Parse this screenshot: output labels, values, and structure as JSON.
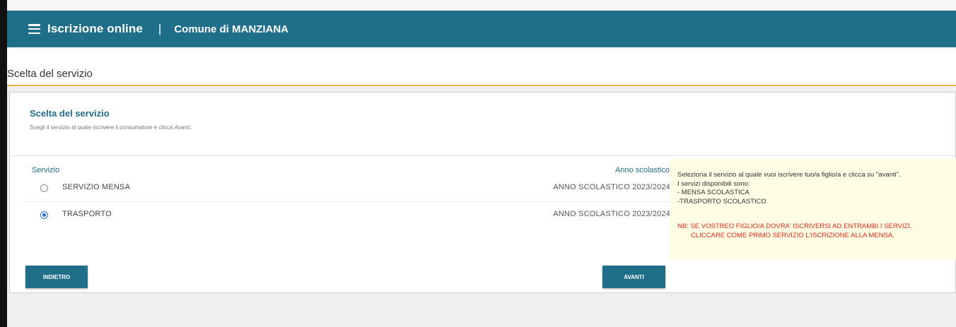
{
  "navbar": {
    "menu_icon": "hamburger-menu-icon",
    "title": "Iscrizione online",
    "separator": "|",
    "comune": "Comune di MANZIANA"
  },
  "page": {
    "title": "Scelta del servizio"
  },
  "card": {
    "title": "Scelta del servizio",
    "subtitle_prefix": "Scegli il servizio al quale iscrivere il consumatore e clicca ",
    "subtitle_italic": "Avanti",
    "subtitle_suffix": ".",
    "columns": {
      "service": "Servizio",
      "year": "Anno scolastico"
    },
    "services": [
      {
        "name": "SERVIZIO MENSA",
        "year": "ANNO SCOLASTICO 2023/2024",
        "selected": false
      },
      {
        "name": "TRASPORTO",
        "year": "ANNO SCOLASTICO 2023/2024",
        "selected": true
      }
    ]
  },
  "info": {
    "line1": "Seleziona il servizio al quale vuoi iscrivere tuo/a figlio/a e clicca su \"avanti\".",
    "line2": "I servizi disponibili sono:",
    "line3": "- MENSA SCOLASTICA",
    "line4": "-TRASPORTO SCOLASTICO",
    "nb1": "NB: SE VOSTREO FIGLIO/A DOVRA' ISCRIVERSI AD ENTRAMBI I SERVIZI.",
    "nb2": "CLICCARE COME PRIMO SERVIZIO L'ISCRIZIONE ALLA MENSA."
  },
  "buttons": {
    "back": "INDIETRO",
    "next": "AVANTI"
  },
  "colors": {
    "primary": "#1f6f8b",
    "accent_line": "#e8b24a",
    "info_bg": "#fffde3",
    "warning_text": "#e0261d",
    "radio_selected": "#2b6fd6"
  }
}
